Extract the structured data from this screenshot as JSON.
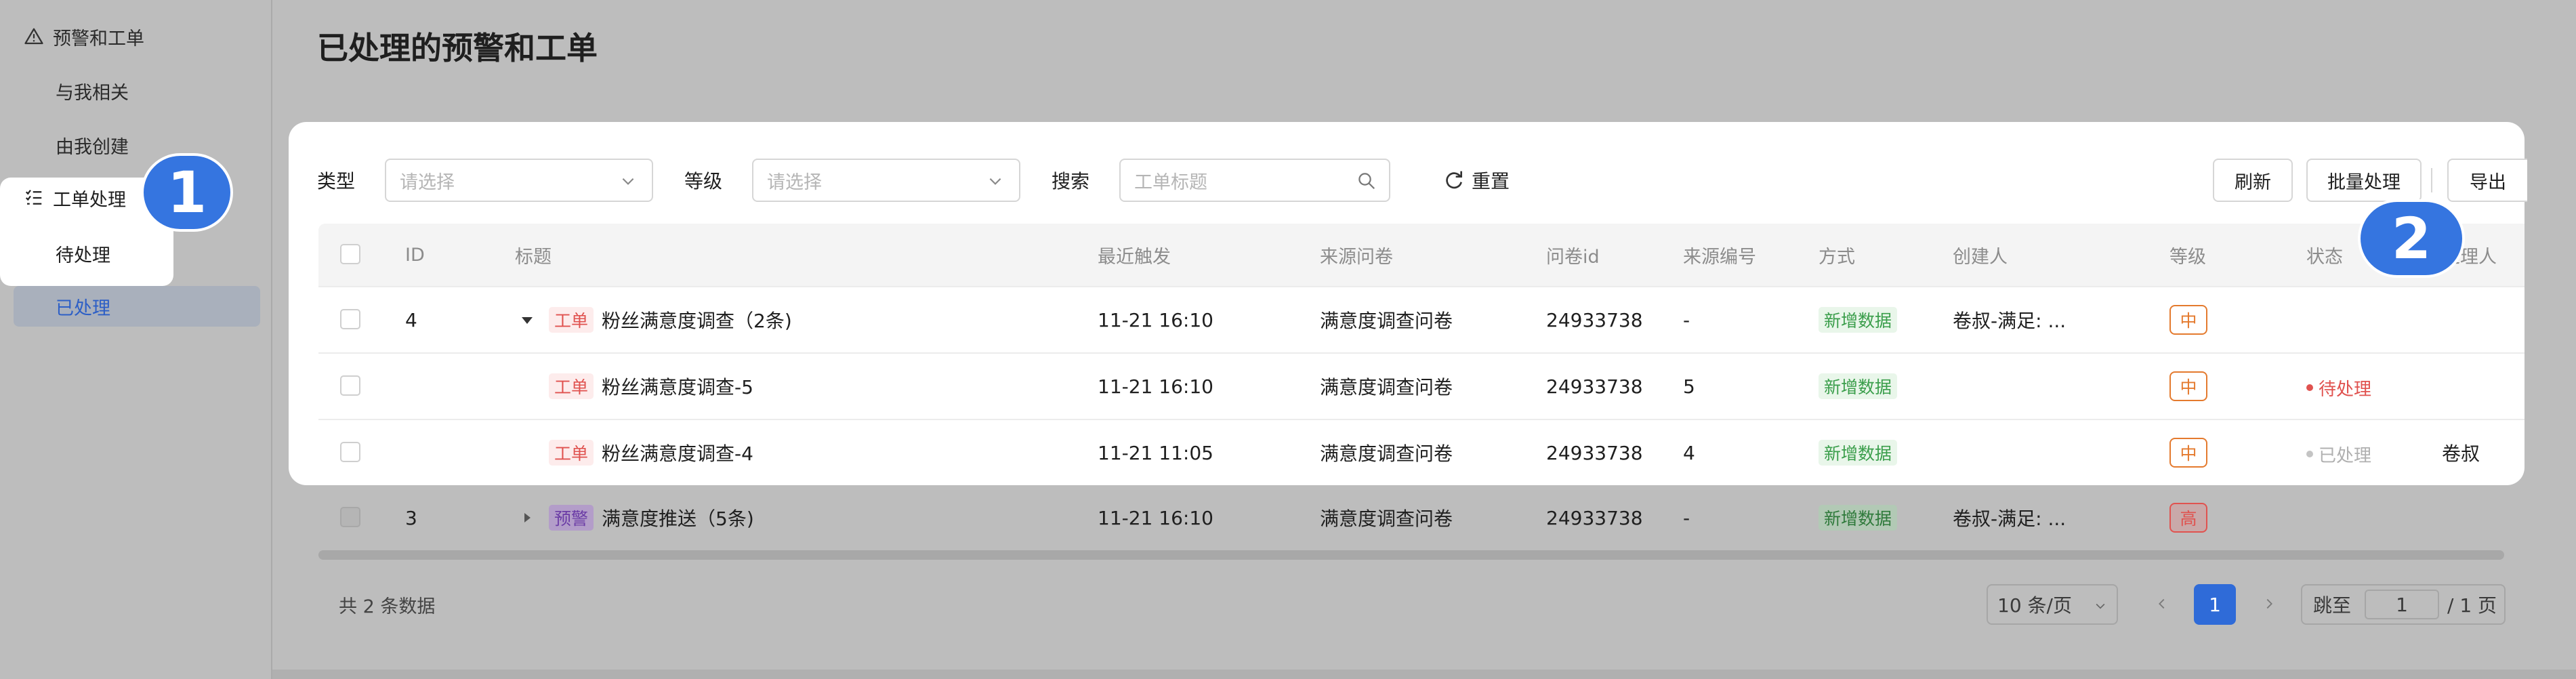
{
  "sidebar": {
    "group_label": "预警和工单",
    "items": [
      {
        "label": "与我相关"
      },
      {
        "label": "由我创建"
      }
    ],
    "ticket_group_label": "工单处理",
    "ticket_items": [
      {
        "label": "待处理"
      },
      {
        "label": "已处理"
      }
    ]
  },
  "badges": {
    "one": "1",
    "two": "2"
  },
  "page": {
    "title": "已处理的预警和工单"
  },
  "filters": {
    "type_label": "类型",
    "type_placeholder": "请选择",
    "level_label": "等级",
    "level_placeholder": "请选择",
    "search_label": "搜索",
    "search_placeholder": "工单标题",
    "reset_label": "重置"
  },
  "toolbar": {
    "refresh": "刷新",
    "batch": "批量处理",
    "export": "导出"
  },
  "table": {
    "columns": [
      "ID",
      "标题",
      "最近触发",
      "来源问卷",
      "问卷id",
      "来源编号",
      "方式",
      "创建人",
      "等级",
      "状态",
      "处理人"
    ],
    "rows": [
      {
        "id": "4",
        "tag": "工单",
        "title": "粉丝满意度调查（2条)",
        "time": "11-21 16:10",
        "survey": "满意度调查问卷",
        "survey_id": "24933738",
        "source_no": "-",
        "method": "新增数据",
        "creator": "卷叔-满足: ...",
        "level": "中",
        "status": "",
        "handler": ""
      },
      {
        "id": "",
        "tag": "工单",
        "title": "粉丝满意度调查-5",
        "time": "11-21 16:10",
        "survey": "满意度调查问卷",
        "survey_id": "24933738",
        "source_no": "5",
        "method": "新增数据",
        "creator": "",
        "level": "中",
        "status": "待处理",
        "handler": ""
      },
      {
        "id": "",
        "tag": "工单",
        "title": "粉丝满意度调查-4",
        "time": "11-21 11:05",
        "survey": "满意度调查问卷",
        "survey_id": "24933738",
        "source_no": "4",
        "method": "新增数据",
        "creator": "",
        "level": "中",
        "status": "已处理",
        "handler": "卷叔"
      },
      {
        "id": "3",
        "tag": "预警",
        "title": "满意度推送（5条)",
        "time": "11-21 16:10",
        "survey": "满意度调查问卷",
        "survey_id": "24933738",
        "source_no": "-",
        "method": "新增数据",
        "creator": "卷叔-满足: ...",
        "level": "高",
        "status": "",
        "handler": ""
      }
    ]
  },
  "footer": {
    "total": "共 2 条数据",
    "page_size": "10 条/页",
    "current_page": "1",
    "jump_label": "跳至",
    "jump_value": "1",
    "total_pages": "/ 1 页"
  },
  "colors": {
    "accent": "#2f6bd8",
    "badge": "#3575e0",
    "ticket_tag": "#e0524f",
    "alert_tag": "#8e5bd0",
    "mid_level": "#e47a2e"
  }
}
